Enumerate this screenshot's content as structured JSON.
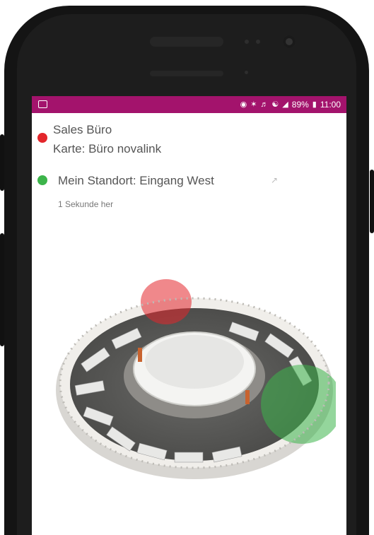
{
  "statusbar": {
    "battery": "89%",
    "time": "11:00",
    "icons": [
      "location-icon",
      "bluetooth-icon",
      "mute-icon",
      "wifi-icon",
      "signal-icon",
      "battery-icon"
    ]
  },
  "target": {
    "title": "Sales Büro",
    "map_label": "Karte: Büro novalink",
    "marker_color": "#e3262b"
  },
  "my_location": {
    "label": "Mein Standort: Eingang West",
    "time_ago": "1 Sekunde her",
    "marker_color": "#3cb44a"
  },
  "theme": {
    "statusbar_color": "#a3136c"
  },
  "map": {
    "name": "floorplan-3d-office"
  }
}
